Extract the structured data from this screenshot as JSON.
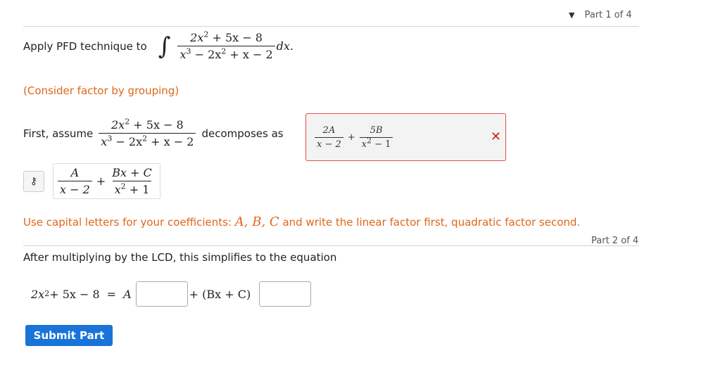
{
  "part1": {
    "toggle_glyph": "▼",
    "label": "Part 1 of 4"
  },
  "part2": {
    "label": "Part 2 of 4"
  },
  "apply": {
    "text": "Apply PFD technique to",
    "integral_sign": "∫",
    "num_a": "2x",
    "num_a_exp": "2",
    "num_b": " + 5x − 8",
    "den_a": "x",
    "den_a_exp": "3",
    "den_b": " − 2x",
    "den_b_exp": "2",
    "den_c": " + x − 2",
    "dx": "dx."
  },
  "hint": "(Consider factor by grouping)",
  "assume": {
    "text": "First, assume",
    "decomposes_text": "decomposes as"
  },
  "student_answer": {
    "frac1_num": "2A",
    "frac1_den": "x − 2",
    "plus": "+",
    "frac2_num": "5B",
    "frac2_den_a": "x",
    "frac2_den_exp": "2",
    "frac2_den_b": " − 1",
    "status": "incorrect",
    "status_glyph": "✕"
  },
  "correct_answer": {
    "key_icon": "key-icon",
    "key_glyph": "⚷",
    "frac1_num": "A",
    "frac1_den": "x − 2",
    "plus": "+",
    "frac2_num": "Bx + C",
    "frac2_den_a": "x",
    "frac2_den_exp": "2",
    "frac2_den_b": " + 1"
  },
  "instructions": {
    "text_a": "Use capital letters for your coefficients: ",
    "math": "A, B, C",
    "text_b": " and write the linear factor first, quadratic factor second."
  },
  "after_text": "After multiplying by the LCD, this simplifies to the equation",
  "equation": {
    "lhs_a": "2x",
    "lhs_exp": "2",
    "lhs_b": " + 5x − 8",
    "equals": "=",
    "coef_a": "A",
    "plus_term": "+ (Bx + C)",
    "input1_value": "",
    "input2_value": ""
  },
  "submit_label": "Submit Part",
  "colors": {
    "accent": "#1a73d9",
    "hint": "#e0661a",
    "error": "#cc1f1f"
  }
}
